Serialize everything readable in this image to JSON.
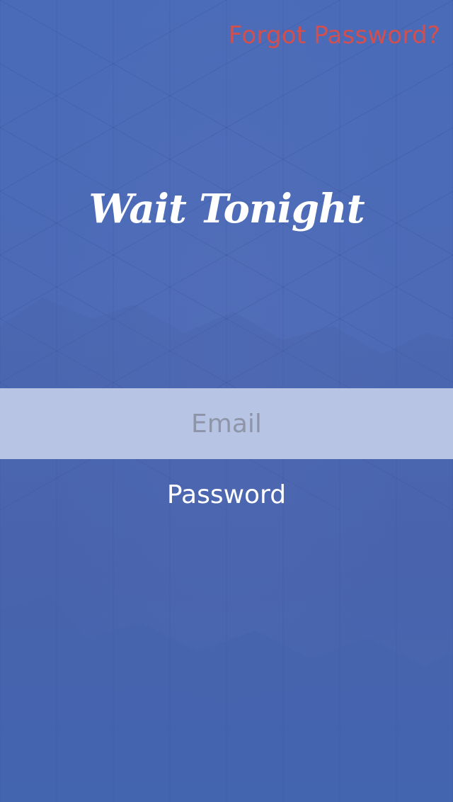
{
  "header": {
    "forgot_password_label": "Forgot Password?"
  },
  "brand": {
    "logo_text": "Wait Tonight"
  },
  "form": {
    "email_placeholder": "Email",
    "password_placeholder": "Password"
  },
  "colors": {
    "background": "#4768b4",
    "accent_link": "#d1504f",
    "email_field_bg": "#b8c4e3",
    "text_white": "#ffffff"
  }
}
